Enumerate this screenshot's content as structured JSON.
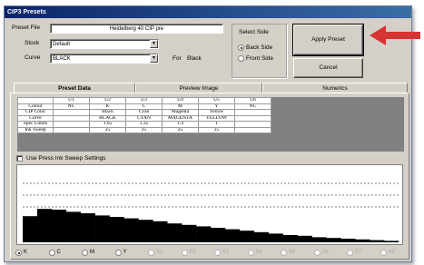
{
  "window": {
    "title": "CIP3 Presets"
  },
  "form": {
    "preset_file_label": "Preset File",
    "preset_file_value": "Heidelberg 40 CIP pre",
    "stock_label": "Stock",
    "stock_value": "Default",
    "curve_label": "Curve",
    "curve_value": "BLACK",
    "for_label": "For",
    "for_value": "Black"
  },
  "select_side": {
    "title": "Select Side",
    "options": [
      {
        "label": "Back Side",
        "selected": true
      },
      {
        "label": "Front Side",
        "selected": false
      }
    ]
  },
  "buttons": {
    "apply": "Apply Preset",
    "cancel": "Cancel"
  },
  "tabs": [
    {
      "label": "Preset Data",
      "active": true
    },
    {
      "label": "Preview Image",
      "active": false
    },
    {
      "label": "Numerics",
      "active": false
    }
  ],
  "table": {
    "columns": [
      "U1",
      "U2",
      "U3",
      "U4",
      "U5",
      "U6"
    ],
    "rows": [
      {
        "label": "Colour",
        "cells": [
          "NC",
          "K",
          "C",
          "M",
          "Y",
          "NC"
        ]
      },
      {
        "label": "CIP Color",
        "cells": [
          "",
          "Black",
          "Cyan",
          "Magenta",
          "Yellow",
          ""
        ]
      },
      {
        "label": "Curve",
        "cells": [
          "",
          "BLACK",
          "CYAN",
          "MAGENTA",
          "YELLOW",
          ""
        ]
      },
      {
        "label": "Spec Limits",
        "cells": [
          "",
          "1.65",
          "1.35",
          "1.4",
          "1",
          ""
        ]
      },
      {
        "label": "Ink Sweep",
        "cells": [
          "",
          "25",
          "25",
          "25",
          "25",
          ""
        ]
      }
    ]
  },
  "ink_sweep_checkbox": {
    "label": "Use Press Ink Sweep Settings",
    "checked": false
  },
  "ink_profile": {
    "levels": [
      0.36,
      0.46,
      0.45,
      0.42,
      0.4,
      0.37,
      0.35,
      0.33,
      0.31,
      0.29,
      0.26,
      0.24,
      0.22,
      0.2,
      0.18,
      0.16,
      0.14,
      0.12,
      0.1,
      0.09,
      0.07,
      0.06,
      0.05,
      0.04,
      0.03,
      0.02
    ]
  },
  "color_selector": {
    "options": [
      {
        "label": "K",
        "selected": true,
        "enabled": true
      },
      {
        "label": "C",
        "selected": false,
        "enabled": true
      },
      {
        "label": "M",
        "selected": false,
        "enabled": true
      },
      {
        "label": "Y",
        "selected": false,
        "enabled": true
      },
      {
        "label": "S1",
        "selected": false,
        "enabled": false
      },
      {
        "label": "S2",
        "selected": false,
        "enabled": false
      },
      {
        "label": "S3",
        "selected": false,
        "enabled": false
      },
      {
        "label": "S4",
        "selected": false,
        "enabled": false
      },
      {
        "label": "S5",
        "selected": false,
        "enabled": false
      },
      {
        "label": "S6",
        "selected": false,
        "enabled": false
      },
      {
        "label": "S7",
        "selected": false,
        "enabled": false
      },
      {
        "label": "S8",
        "selected": false,
        "enabled": false
      }
    ]
  },
  "colors": {
    "title_bar": "#0a246a",
    "arrow": "#d63333",
    "dialog_face": "#d4d0c8"
  }
}
